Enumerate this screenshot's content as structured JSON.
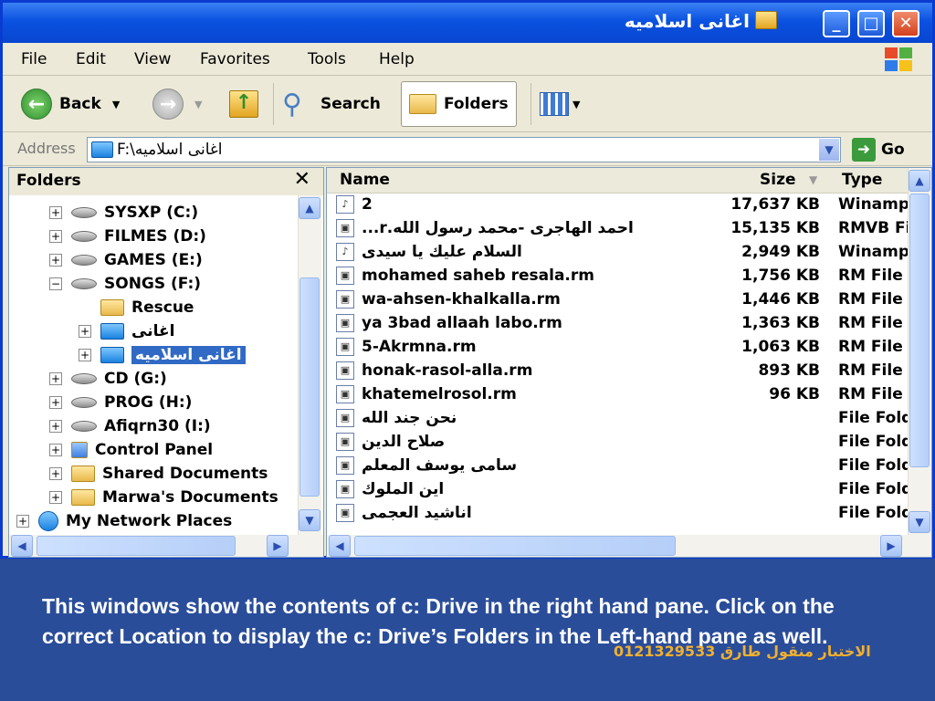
{
  "window": {
    "title": "اغانى اسلاميه",
    "controls": {
      "minimize": "_",
      "maximize": "□",
      "close": "✕"
    }
  },
  "menu": [
    "File",
    "Edit",
    "View",
    "Favorites",
    "Tools",
    "Help"
  ],
  "toolbar": {
    "back": "Back",
    "search": "Search",
    "folders": "Folders"
  },
  "address": {
    "label": "Address",
    "value": "F:\\اغانى اسلاميه",
    "go": "Go"
  },
  "folders_pane": {
    "title": "Folders",
    "close_glyph": "✕",
    "items": [
      {
        "label": "SYSXP (C:)",
        "toggle": "+",
        "icon": "drive-icon"
      },
      {
        "label": "FILMES (D:)",
        "toggle": "+",
        "icon": "drive-icon"
      },
      {
        "label": "GAMES (E:)",
        "toggle": "+",
        "icon": "drive-icon"
      },
      {
        "label": "SONGS (F:)",
        "toggle": "−",
        "icon": "drive-icon"
      },
      {
        "label": "Rescue",
        "toggle": "",
        "icon": "folder-icon"
      },
      {
        "label": "اغانى",
        "toggle": "+",
        "icon": "folder-icon"
      },
      {
        "label": "اغانى اسلاميه",
        "toggle": "+",
        "icon": "folder-icon",
        "selected": true
      },
      {
        "label": "CD (G:)",
        "toggle": "+",
        "icon": "drive-icon"
      },
      {
        "label": "PROG (H:)",
        "toggle": "+",
        "icon": "drive-icon"
      },
      {
        "label": "Afiqrn30 (I:)",
        "toggle": "+",
        "icon": "drive-icon"
      },
      {
        "label": "Control Panel",
        "toggle": "+",
        "icon": "control-panel-icon"
      },
      {
        "label": "Shared Documents",
        "toggle": "+",
        "icon": "folder-icon"
      },
      {
        "label": "Marwa's Documents",
        "toggle": "+",
        "icon": "folder-icon"
      },
      {
        "label": "My Network Places",
        "toggle": "+",
        "icon": "network-icon"
      }
    ]
  },
  "files_pane": {
    "columns": {
      "name": "Name",
      "size": "Size",
      "type": "Type"
    },
    "rows": [
      {
        "name": "2",
        "size": "17,637 KB",
        "type": "Winamp"
      },
      {
        "name": "احمد الهاجرى -محمد رسول الله.r...",
        "size": "15,135 KB",
        "type": "RMVB Fi"
      },
      {
        "name": "السلام عليك يا سيدى",
        "size": "2,949 KB",
        "type": "Winamp"
      },
      {
        "name": "mohamed saheb resala.rm",
        "size": "1,756 KB",
        "type": "RM File"
      },
      {
        "name": "wa-ahsen-khalkalla.rm",
        "size": "1,446 KB",
        "type": "RM File"
      },
      {
        "name": "ya 3bad allaah labo.rm",
        "size": "1,363 KB",
        "type": "RM File"
      },
      {
        "name": "5-Akrmna.rm",
        "size": "1,063 KB",
        "type": "RM File"
      },
      {
        "name": "honak-rasol-alla.rm",
        "size": "893 KB",
        "type": "RM File"
      },
      {
        "name": "khatemelrosol.rm",
        "size": "96 KB",
        "type": "RM File"
      },
      {
        "name": "نحن جند الله",
        "size": "",
        "type": "File Fold"
      },
      {
        "name": "صلاح الدين",
        "size": "",
        "type": "File Fold"
      },
      {
        "name": "سامى يوسف المعلم",
        "size": "",
        "type": "File Fold"
      },
      {
        "name": "اين الملوك",
        "size": "",
        "type": "File Fold"
      },
      {
        "name": "اناشيد العجمى",
        "size": "",
        "type": "File Fold"
      }
    ]
  },
  "slide": {
    "text": "This windows show the contents of c: Drive in the right hand pane. Click on the correct Location to display the c: Drive’s Folders in the Left-hand pane as well.",
    "stamp": "الاختبار منقول طارق 0121329533"
  }
}
